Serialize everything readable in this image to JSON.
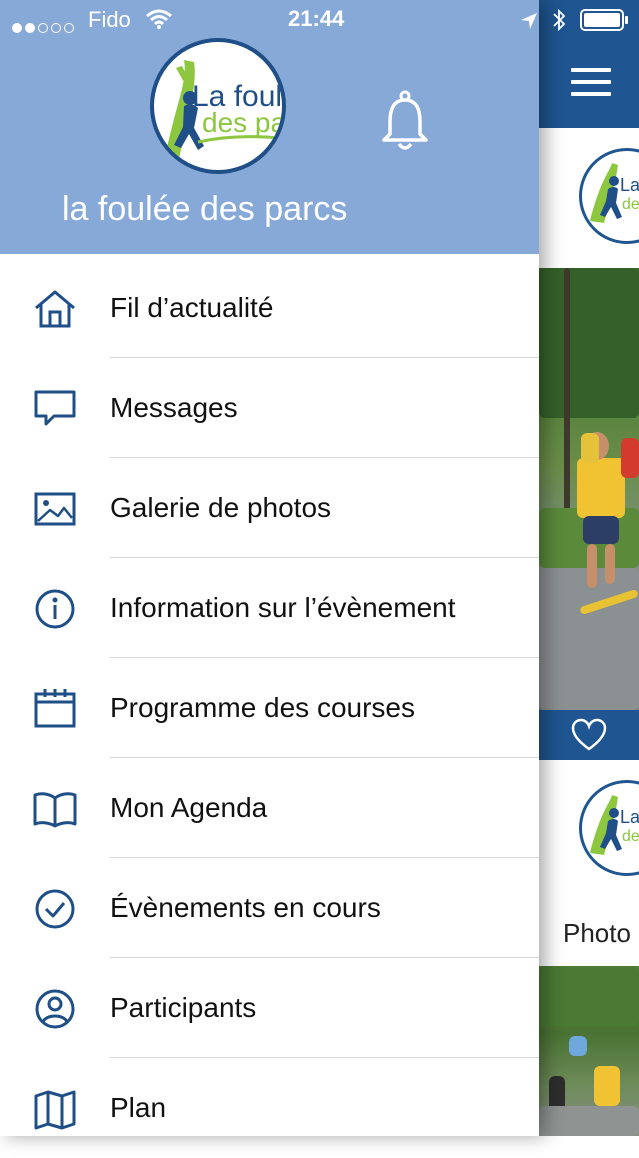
{
  "status_bar": {
    "carrier": "Fido",
    "time": "21:44"
  },
  "header": {
    "app_name": "la foulée des parcs",
    "logo_text_line1": "La foulée",
    "logo_text_line2": "des parcs"
  },
  "menu": {
    "items": [
      {
        "label": "Fil d’actualité",
        "icon": "home-icon"
      },
      {
        "label": "Messages",
        "icon": "chat-bubble-icon"
      },
      {
        "label": "Galerie de photos",
        "icon": "image-icon"
      },
      {
        "label": "Information sur l’évènement",
        "icon": "info-icon"
      },
      {
        "label": "Programme des courses",
        "icon": "calendar-icon"
      },
      {
        "label": "Mon Agenda",
        "icon": "book-icon"
      },
      {
        "label": "Évènements en cours",
        "icon": "clock-check-icon"
      },
      {
        "label": "Participants",
        "icon": "user-circle-icon"
      },
      {
        "label": "Plan",
        "icon": "map-icon"
      }
    ]
  },
  "background_feed": {
    "photo_label": "Photo"
  },
  "colors": {
    "header_bg": "#87a9d8",
    "brand_blue": "#1f5590",
    "icon_blue": "#1f4f86",
    "logo_green": "#8dc63f"
  }
}
